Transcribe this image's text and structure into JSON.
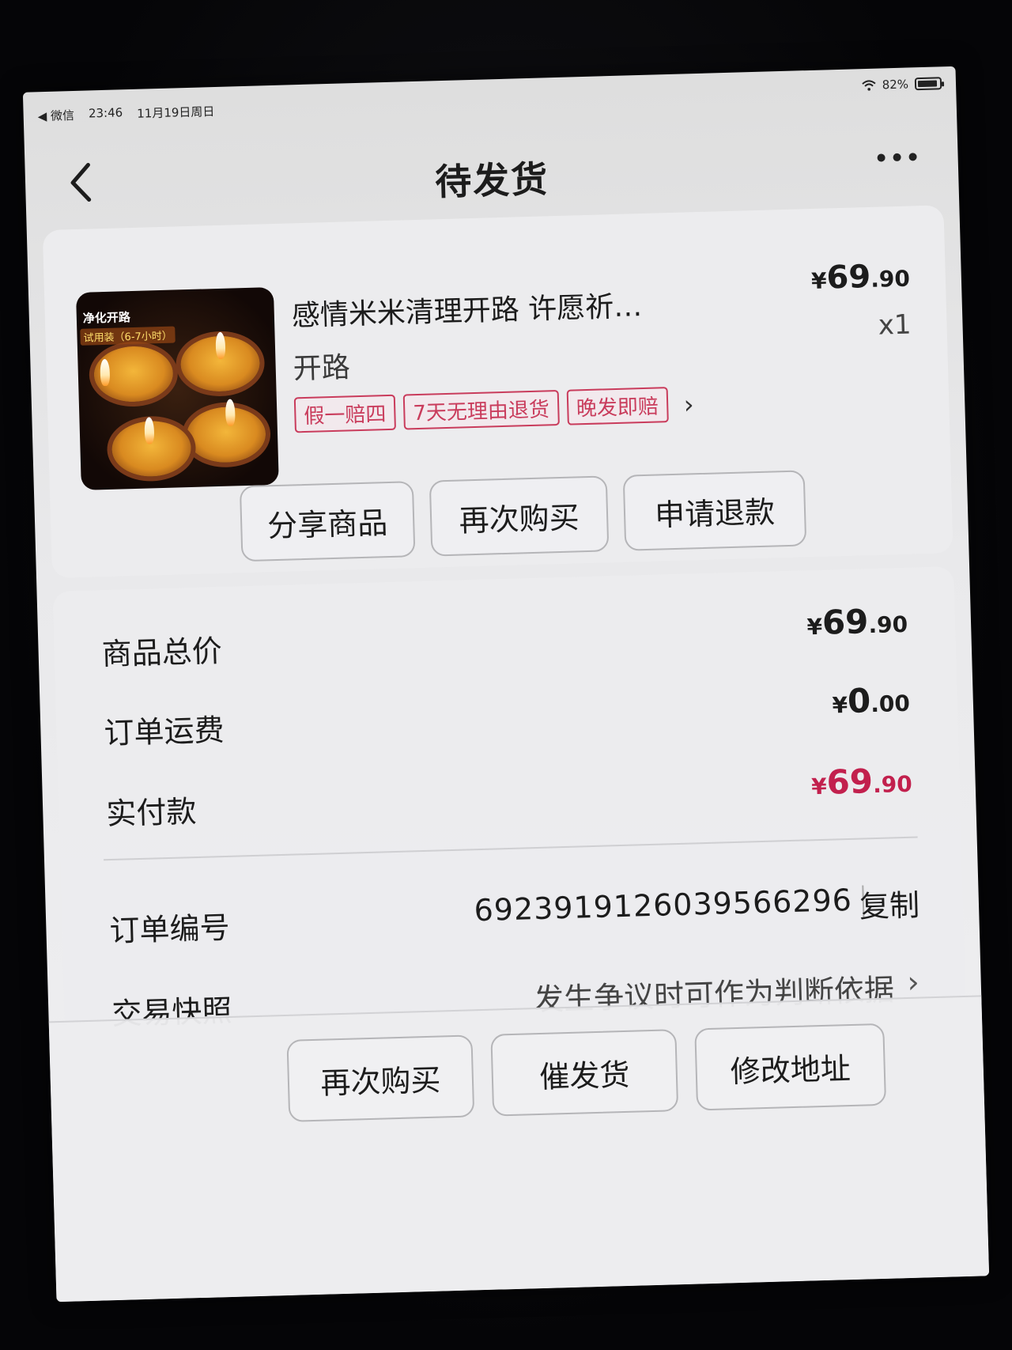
{
  "status_bar": {
    "back_app": "◀ 微信",
    "time": "23:46",
    "date": "11月19日周日",
    "battery": "82%"
  },
  "nav": {
    "title": "待发货"
  },
  "product": {
    "title": "感情米米清理开路 许愿祈…",
    "spec": "开路",
    "price_yen": "¥",
    "price_int": "69",
    "price_dec": ".90",
    "qty": "x1",
    "image_text_1": "净化开路",
    "image_text_2": "试用装（6-7小时）",
    "tags": [
      "假一赔四",
      "7天无理由退货",
      "晚发即赔"
    ],
    "actions": [
      "分享商品",
      "再次购买",
      "申请退款"
    ]
  },
  "summary": {
    "goods_total_label": "商品总价",
    "goods_total_int": "69",
    "goods_total_dec": ".90",
    "shipping_label": "订单运费",
    "shipping_int": "0",
    "shipping_dec": ".00",
    "paid_label": "实付款",
    "paid_int": "69",
    "paid_dec": ".90",
    "yen": "¥"
  },
  "order": {
    "number_label": "订单编号",
    "number": "6923919126039566296",
    "copy_label": "复制",
    "snapshot_label": "交易快照",
    "snapshot_hint": "发生争议时可作为判断依据"
  },
  "bottom_actions": [
    "再次购买",
    "催发货",
    "修改地址"
  ],
  "colors": {
    "accent_red": "#c2204d",
    "tag_red": "#c93c5c"
  }
}
